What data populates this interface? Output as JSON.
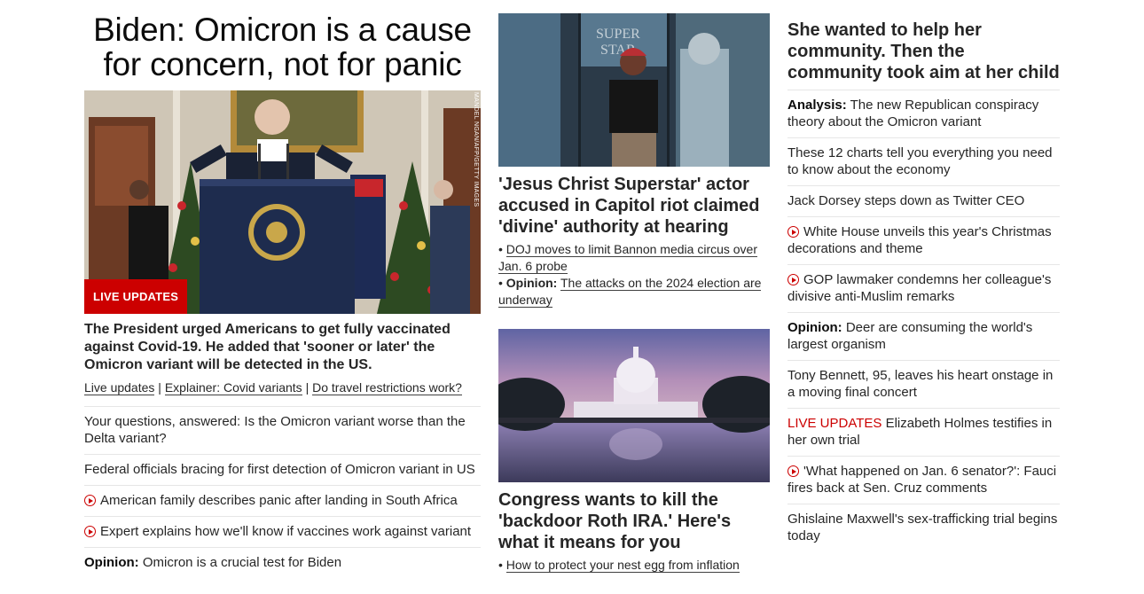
{
  "col1": {
    "headline": "Biden: Omicron is a cause for concern, not for panic",
    "photo_credit": "MANDEL NGAN/AFP/GETTY IMAGES",
    "badge": "LIVE UPDATES",
    "description": "The President urged Americans to get fully vaccinated against Covid-19. He added that 'sooner or later' the Omicron variant will be detected in the US.",
    "links": [
      "Live updates",
      "Explainer: Covid variants",
      "Do travel restrictions work?"
    ],
    "separator": "|",
    "items": [
      {
        "text": "Your questions, answered: Is the Omicron variant worse than the Delta variant?"
      },
      {
        "text": "Federal officials bracing for first detection of Omicron variant in US"
      },
      {
        "text": "American family describes panic after landing in South Africa",
        "icon": "play-icon"
      },
      {
        "text": "Expert explains how we'll know if vaccines work against variant",
        "icon": "play-icon"
      },
      {
        "prefix": "Opinion:",
        "text": "Omicron is a crucial test for Biden"
      }
    ]
  },
  "col2": {
    "story1": {
      "title": "'Jesus Christ Superstar' actor accused in Capitol riot claimed 'divine' authority at hearing",
      "bullet1": "DOJ moves to limit Bannon media circus over Jan. 6 probe",
      "bullet2_prefix": "Opinion:",
      "bullet2": "The attacks on the 2024 election are underway"
    },
    "story2": {
      "title": "Congress wants to kill the 'backdoor Roth IRA.' Here's what it means for you",
      "bullet1": "How to protect your nest egg from inflation"
    },
    "bullet_char": "•"
  },
  "col3": {
    "headline": "She wanted to help her community. Then the community took aim at her child",
    "items": [
      {
        "prefix": "Analysis:",
        "text": "The new Republican conspiracy theory about the Omicron variant"
      },
      {
        "text": "These 12 charts tell you everything you need to know about the economy"
      },
      {
        "text": "Jack Dorsey steps down as Twitter CEO"
      },
      {
        "text": "White House unveils this year's Christmas decorations and theme",
        "icon": "play-icon"
      },
      {
        "text": "GOP lawmaker condemns her colleague's divisive anti-Muslim remarks",
        "icon": "play-icon"
      },
      {
        "prefix": "Opinion:",
        "text": "Deer are consuming the world's largest organism"
      },
      {
        "text": "Tony Bennett, 95, leaves his heart onstage in a moving final concert"
      },
      {
        "live": "LIVE UPDATES",
        "text": "Elizabeth Holmes testifies in her own trial"
      },
      {
        "text": "'What happened on Jan. 6 senator?': Fauci fires back at Sen. Cruz comments",
        "icon": "play-icon"
      },
      {
        "text": "Ghislaine Maxwell's sex-trafficking trial begins today"
      }
    ]
  },
  "colors": {
    "accent_red": "#cc0000",
    "text": "#262626",
    "divider": "#e6e6e6"
  }
}
